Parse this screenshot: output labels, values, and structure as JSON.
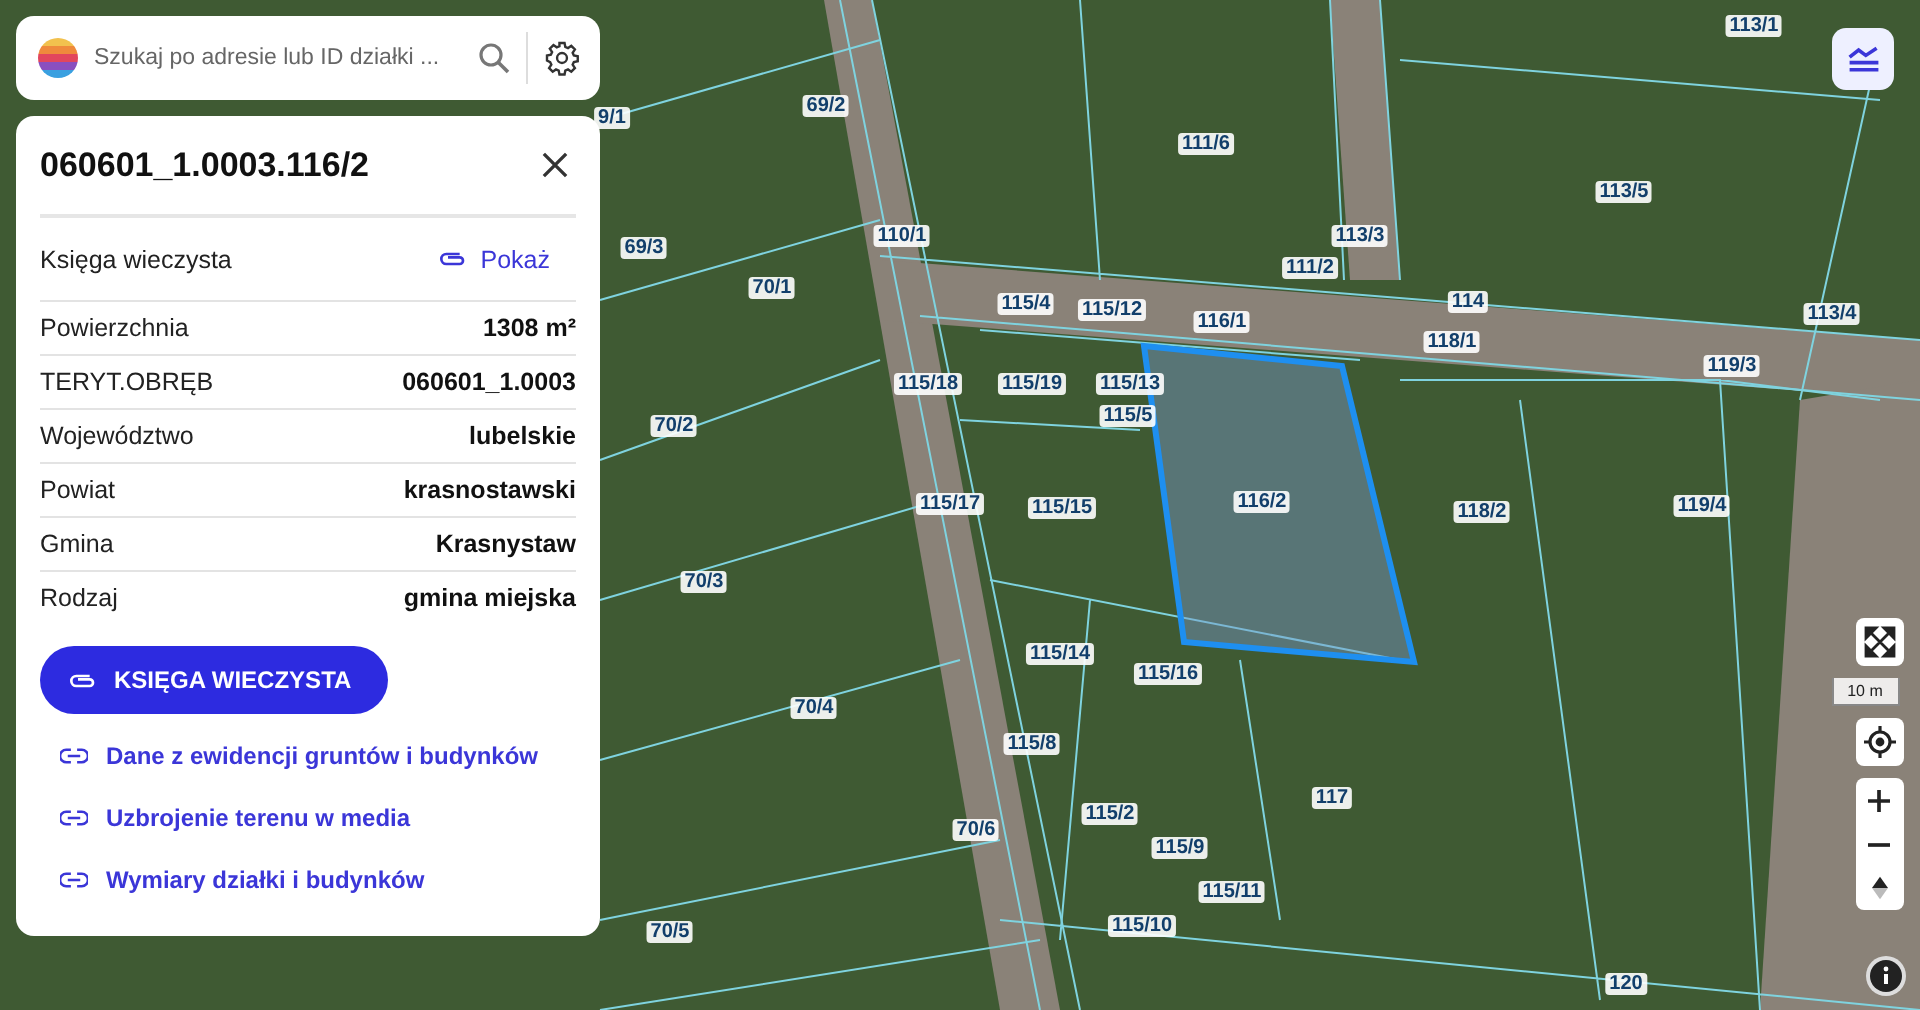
{
  "search": {
    "placeholder": "Szukaj po adresie lub ID działki ..."
  },
  "parcel": {
    "title": "060601_1.0003.116/2",
    "land_register": {
      "label": "Księga wieczysta",
      "action": "Pokaż"
    },
    "properties": [
      {
        "label": "Powierzchnia",
        "value": "1308 m²"
      },
      {
        "label": "TERYT.OBRĘB",
        "value": "060601_1.0003"
      },
      {
        "label": "Województwo",
        "value": "lubelskie"
      },
      {
        "label": "Powiat",
        "value": "krasnostawski"
      },
      {
        "label": "Gmina",
        "value": "Krasnystaw"
      },
      {
        "label": "Rodzaj",
        "value": "gmina miejska"
      }
    ],
    "primary_button": "KSIĘGA WIECZYSTA",
    "links": [
      "Dane z ewidencji gruntów i budynków",
      "Uzbrojenie terenu w media",
      "Wymiary działki i budynków"
    ]
  },
  "map": {
    "parcel_labels": [
      "113/1",
      "9/1",
      "69/2",
      "111/6",
      "113/5",
      "69/3",
      "110/1",
      "111/2",
      "113/3",
      "70/1",
      "115/4",
      "115/12",
      "116/1",
      "114",
      "113/4",
      "118/1",
      "119/3",
      "115/18",
      "115/19",
      "115/13",
      "70/2",
      "115/5",
      "115/17",
      "115/15",
      "116/2",
      "118/2",
      "119/4",
      "70/3",
      "115/14",
      "115/16",
      "70/4",
      "115/8",
      "70/6",
      "115/2",
      "117",
      "115/9",
      "115/11",
      "70/5",
      "115/10",
      "120"
    ],
    "scale": "10 m"
  }
}
